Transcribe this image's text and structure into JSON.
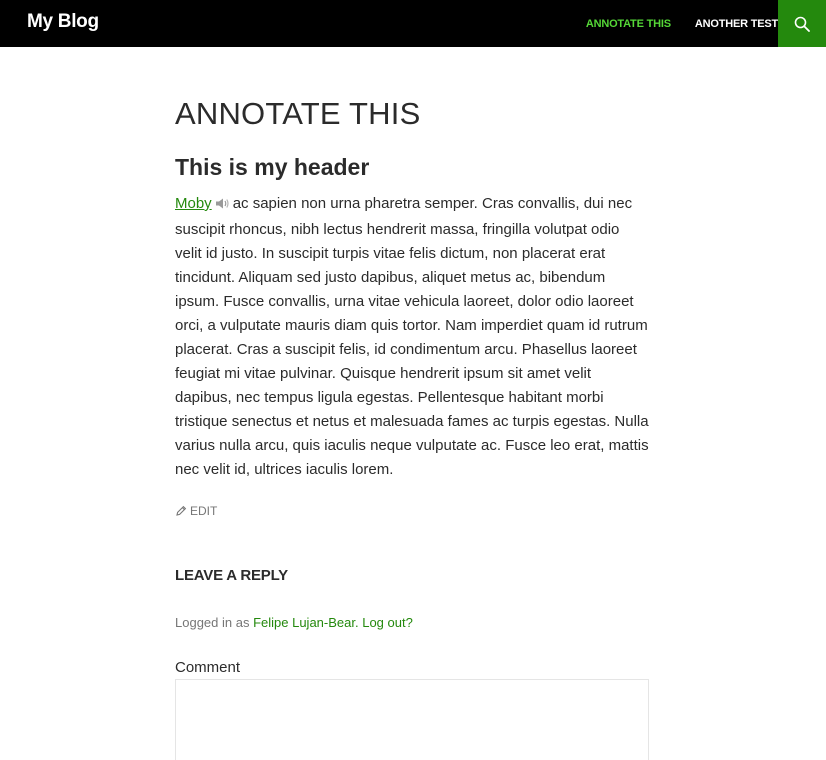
{
  "header": {
    "site_title": "My Blog",
    "nav": [
      {
        "label": "ANNOTATE THIS",
        "current": true
      },
      {
        "label": "ANOTHER TEST",
        "current": false
      }
    ],
    "search_icon": "search-icon"
  },
  "colors": {
    "accent": "#24890d",
    "nav_current": "#55d737",
    "topbar": "#000000"
  },
  "post": {
    "title": "ANNOTATE THIS",
    "header": "This is my header",
    "moby_link": "Moby",
    "speaker_icon": "speaker-icon",
    "body": "ac sapien non urna pharetra semper. Cras convallis, dui nec suscipit rhoncus, nibh lectus hendrerit massa, fringilla volutpat odio velit id justo. In suscipit turpis vitae felis dictum, non placerat erat tincidunt. Aliquam sed justo dapibus, aliquet metus ac, bibendum ipsum. Fusce convallis, urna vitae vehicula laoreet, dolor odio laoreet orci, a vulputate mauris diam quis tortor. Nam imperdiet quam id rutrum placerat. Cras a suscipit felis, id condimentum arcu. Phasellus laoreet feugiat mi vitae pulvinar. Quisque hendrerit ipsum sit amet velit dapibus, nec tempus ligula egestas. Pellentesque habitant morbi tristique senectus et netus et malesuada fames ac turpis egestas. Nulla varius nulla arcu, quis iaculis neque vulputate ac. Fusce leo erat, mattis nec velit id, ultrices iaculis lorem.",
    "edit_label": "EDIT"
  },
  "reply": {
    "title": "LEAVE A REPLY",
    "logged_in_prefix": "Logged in as",
    "user_name": "Felipe Lujan-Bear.",
    "logout_label": "Log out?",
    "comment_label": "Comment",
    "comment_value": ""
  }
}
